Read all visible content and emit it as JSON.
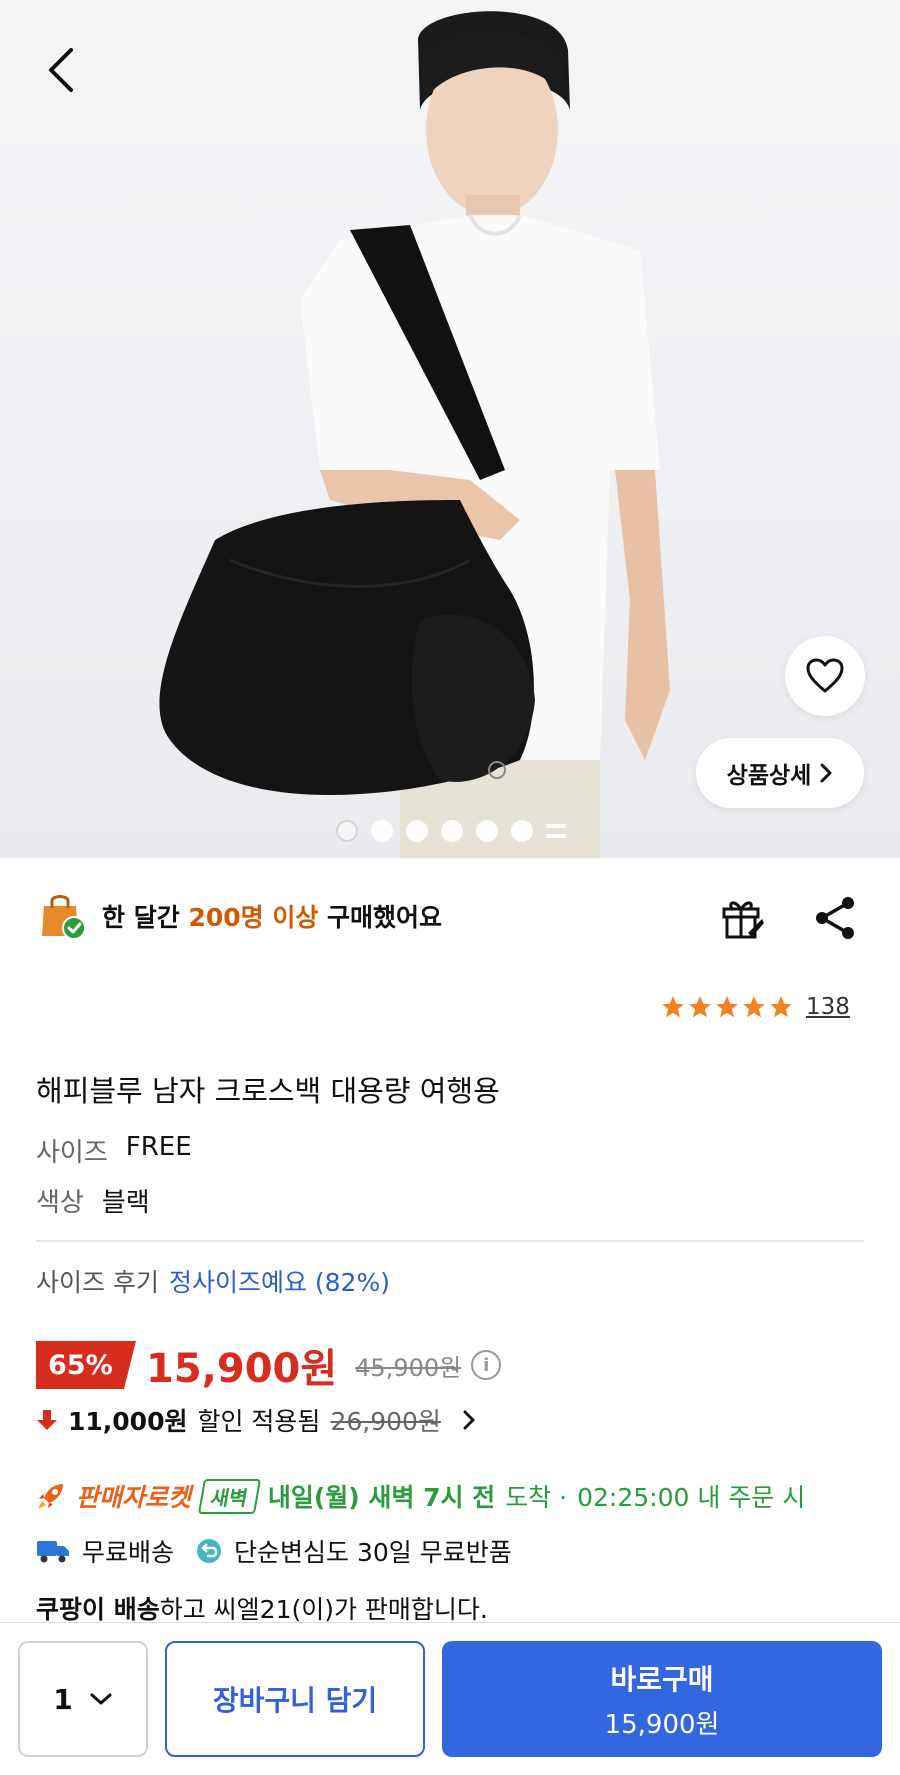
{
  "hero": {
    "detail_label": "상품상세",
    "carousel": {
      "total": 7,
      "active": 1
    }
  },
  "purchase_banner": {
    "prefix": "한 달간",
    "highlight": "200명 이상",
    "suffix": "구매했어요"
  },
  "rating": {
    "stars": 5,
    "count": "138"
  },
  "product": {
    "title": "해피블루 남자 크로스백 대용량 여행용",
    "options": [
      {
        "key": "사이즈",
        "value": "FREE"
      },
      {
        "key": "색상",
        "value": "블랙"
      }
    ],
    "size_review_label": "사이즈 후기",
    "size_review_value": "정사이즈예요 (82%)"
  },
  "price": {
    "discount": "65%",
    "sale": "15,900원",
    "original": "45,900원",
    "coupon_amount": "11,000원",
    "coupon_text": "할인 적용됨",
    "coupon_was": "26,900원"
  },
  "delivery": {
    "rocket_label": "판매자로켓",
    "dawn_badge": "새벽",
    "arrive_bold": "내일(월) 새벽 7시 전",
    "arrive_word": "도착 ·",
    "deadline": "02:25:00 내 주문 시",
    "free_shipping": "무료배송",
    "free_return": "단순변심도 30일 무료반품",
    "seller_bold": "쿠팡이 배송",
    "seller_rest": "하고 씨엘21(이)가 판매합니다."
  },
  "bottom_bar": {
    "quantity": "1",
    "cart_label": "장바구니 담기",
    "buy_label": "바로구매",
    "buy_price": "15,900원"
  },
  "colors": {
    "accent_blue": "#3466e0",
    "sale_red": "#d72d21",
    "star_orange": "#f58220",
    "green": "#2a9c3e",
    "rocket_orange": "#e8621a"
  }
}
